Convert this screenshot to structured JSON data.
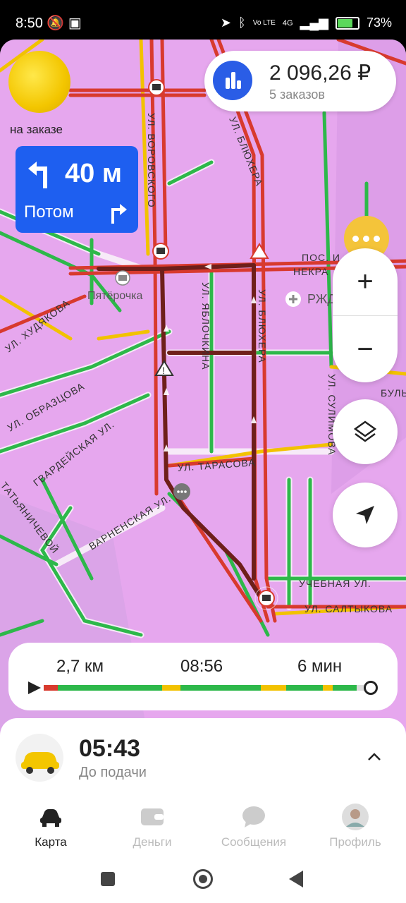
{
  "status_bar": {
    "time": "8:50",
    "battery_percent": "73%",
    "network_label": "4G",
    "volte_label": "Vo LTE"
  },
  "map": {
    "streets": {
      "vorovskogo": "УЛ. ВОРОВСКОГО",
      "blyukhera_top": "УЛ. БЛЮХЕРА",
      "blyukhera_mid": "УЛ. БЛЮХЕРА",
      "yablochkina": "УЛ. ЯБЛОЧКИНА",
      "khudyakova": "УЛ. ХУДЯКОВА",
      "obraztsova": "УЛ. ОБРАЗЦОВА",
      "gvardeyskaya": "ГВАРДЕЙСКАЯ УЛ.",
      "tatyanicheva": "ТАТЬЯНИЧЕВОЙ",
      "varnenskaya": "ВАРНЕНСКАЯ УЛ.",
      "tarasova": "УЛ. ТАРАСОВА",
      "uchebnaya": "УЧЕБНАЯ УЛ.",
      "saltykova": "УЛ. САЛТЫКОВА",
      "sulimova": "УЛ. СУЛИМОВА",
      "pos_nekr": "ПОС. И.",
      "nekr": "НЕКРА",
      "bul": "БУЛЬ"
    },
    "pois": {
      "pyaterochka": "Пятёрочка",
      "rzhd": "РЖД"
    }
  },
  "driver_status": {
    "label": "на заказе"
  },
  "earnings": {
    "amount": "2 096,26 ₽",
    "orders": "5 заказов"
  },
  "navigation": {
    "distance": "40 м",
    "then_label": "Потом"
  },
  "route": {
    "distance": "2,7 км",
    "arrival_time": "08:56",
    "duration": "6 мин"
  },
  "pickup": {
    "time": "05:43",
    "label": "До подачи"
  },
  "tabs": [
    {
      "label": "Карта",
      "icon": "car-icon",
      "active": true
    },
    {
      "label": "Деньги",
      "icon": "wallet-icon",
      "active": false
    },
    {
      "label": "Сообщения",
      "icon": "chat-icon",
      "active": false
    },
    {
      "label": "Профиль",
      "icon": "profile-icon",
      "active": false
    }
  ],
  "colors": {
    "accent_blue": "#1e5ff0",
    "brand_yellow": "#f3c600",
    "traffic_green": "#2db84a",
    "traffic_yellow": "#f2c200",
    "traffic_red": "#d83a2e",
    "route_dark": "#6e1f1a"
  }
}
